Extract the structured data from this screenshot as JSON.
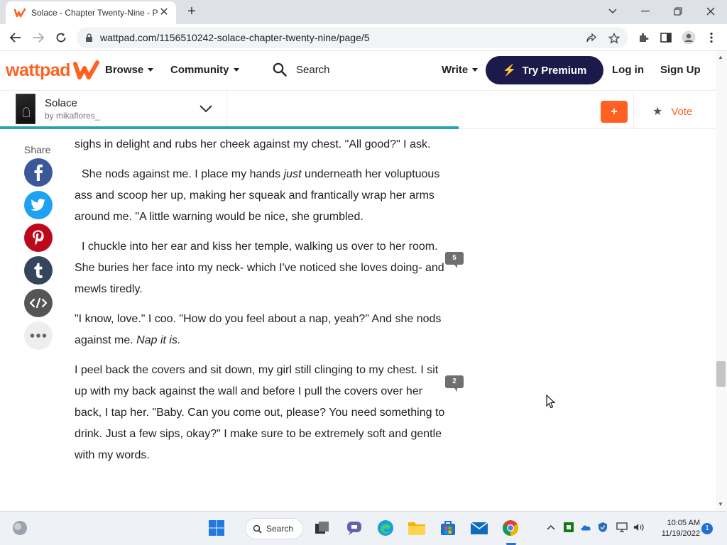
{
  "browser": {
    "tab_title": "Solace - Chapter Twenty-Nine - P",
    "tab_close": "✕",
    "new_tab": "+",
    "url": "wattpad.com/1156510242-solace-chapter-twenty-nine/page/5"
  },
  "wattpad": {
    "logo_text": "wattpad",
    "nav": {
      "browse": "Browse",
      "community": "Community",
      "search": "Search",
      "write": "Write",
      "try_premium": "Try Premium",
      "login": "Log in",
      "signup": "Sign Up"
    },
    "story": {
      "title": "Solace",
      "author": "by mikaflores_",
      "add_label": "+",
      "vote_label": "Vote"
    }
  },
  "share": {
    "label": "Share",
    "buttons": [
      {
        "name": "facebook",
        "glyph": "f",
        "color": "#3b5998"
      },
      {
        "name": "twitter",
        "glyph": "t",
        "color": "#1da1f2"
      },
      {
        "name": "pinterest",
        "glyph": "p",
        "color": "#bd081c"
      },
      {
        "name": "tumblr",
        "glyph": "t",
        "color": "#35465c"
      },
      {
        "name": "embed",
        "glyph": "</>",
        "color": "#555555"
      },
      {
        "name": "more",
        "glyph": "•••",
        "color": "#eeeeee"
      }
    ]
  },
  "content": {
    "p1": "sighs in delight and rubs her cheek against my chest. \"All good?\" I ask.",
    "p2_before": "She nods against me. I place my hands ",
    "p2_em": "just",
    "p2_after": " underneath her voluptuous ass and scoop her up, making her squeak and frantically wrap her arms around me. \"A little warning would be nice, she grumbled.",
    "p3": "I chuckle into her ear and kiss her temple, walking us over to her room. She buries her face into my neck- which I've noticed she loves doing- and mewls tiredly.",
    "p4_before": "\"I know, love.\" I coo. \"How do you feel about a nap, yeah?\" And she nods against me. ",
    "p4_em": "Nap it is.",
    "p5": "I peel back the covers and sit down, my girl still clinging to my chest. I sit up with my back against the wall and before I pull the covers over her back, I tap her. \"Baby. Can you come out, please? You need something to drink. Just a few sips, okay?\" I make sure to be extremely soft and gentle with my words."
  },
  "comments": {
    "badge1": "5",
    "badge2": "2"
  },
  "taskbar": {
    "search_label": "Search",
    "time": "10:05 AM",
    "date": "11/19/2022",
    "notification_count": "1"
  }
}
